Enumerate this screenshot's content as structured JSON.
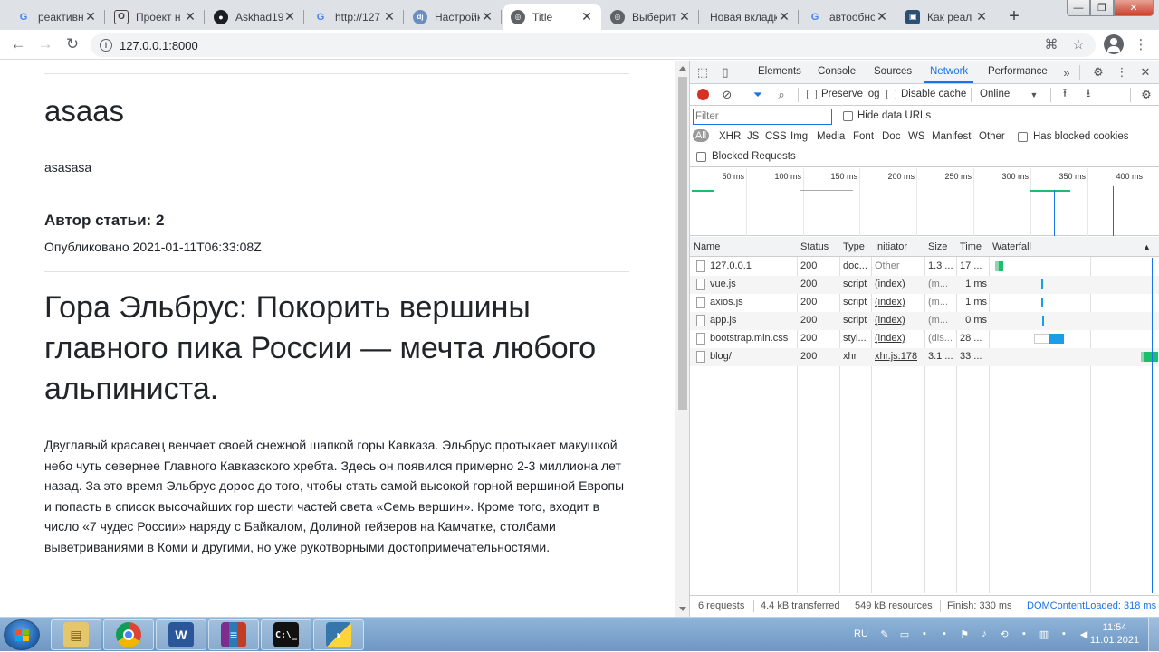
{
  "browser": {
    "tabs": [
      {
        "title": "реактивн",
        "favicon": "G",
        "color": "#4285f4"
      },
      {
        "title": "Проект н",
        "favicon": "◘",
        "color": "#444444"
      },
      {
        "title": "Askhad19",
        "favicon": "●",
        "color": "#1b1f23"
      },
      {
        "title": "http://127",
        "favicon": "G",
        "color": "#4285f4"
      },
      {
        "title": "Настройк",
        "favicon": "dj",
        "color": "#6b8ec2"
      },
      {
        "title": "Title",
        "favicon": "◉",
        "color": "#5f6368"
      },
      {
        "title": "Выберит",
        "favicon": "◉",
        "color": "#5f6368"
      },
      {
        "title": "Новая вкладк",
        "favicon": "",
        "color": "#5f6368"
      },
      {
        "title": "автообно",
        "favicon": "G",
        "color": "#4285f4"
      },
      {
        "title": "Как реал",
        "favicon": "▣",
        "color": "#2d4f73"
      }
    ],
    "url": "127.0.0.1:8000"
  },
  "page": {
    "title": "asaas",
    "body": "asasasa",
    "author": "Автор статьи: 2",
    "published": "Опубликовано 2021-01-11T06:33:08Z",
    "heading": "Гора Эльбрус: Покорить вершины главного пика России — мечта любого альпиниста.",
    "paragraph": "Двуглавый красавец венчает своей снежной шапкой горы Кавказа. Эльбрус протыкает макушкой небо чуть севернее Главного Кавказского хребта. Здесь он появился примерно 2-3 миллиона лет назад. За это время Эльбрус дорос до того, чтобы стать самой высокой горной вершиной Европы и попасть в список высочайших гор шести частей света «Семь вершин». Кроме того, входит в число «7 чудес России» наряду с Байкалом, Долиной гейзеров на Камчатке, столбами выветриваниями в Коми и другими, но уже рукотворными достопримечательностями."
  },
  "devtools": {
    "tabs": [
      "Elements",
      "Console",
      "Sources",
      "Network",
      "Performance"
    ],
    "active_tab": "Network",
    "toolbar": {
      "preserve_log": "Preserve log",
      "disable_cache": "Disable cache",
      "throttle": "Online"
    },
    "filter": {
      "placeholder": "Filter",
      "hide_data_urls": "Hide data URLs",
      "types": [
        "All",
        "XHR",
        "JS",
        "CSS",
        "Img",
        "Media",
        "Font",
        "Doc",
        "WS",
        "Manifest",
        "Other"
      ],
      "has_blocked_cookies": "Has blocked cookies",
      "blocked_requests": "Blocked Requests"
    },
    "overview_ticks": [
      "50 ms",
      "100 ms",
      "150 ms",
      "200 ms",
      "250 ms",
      "300 ms",
      "350 ms",
      "400 ms"
    ],
    "columns": [
      "Name",
      "Status",
      "Type",
      "Initiator",
      "Size",
      "Time",
      "Waterfall"
    ],
    "rows": [
      {
        "name": "127.0.0.1",
        "status": "200",
        "type": "doc...",
        "initiator": "Other",
        "size": "1.3 ...",
        "time": "17 ..."
      },
      {
        "name": "vue.js",
        "status": "200",
        "type": "script",
        "initiator": "(index)",
        "size": "(m...",
        "time": "1 ms"
      },
      {
        "name": "axios.js",
        "status": "200",
        "type": "script",
        "initiator": "(index)",
        "size": "(m...",
        "time": "1 ms"
      },
      {
        "name": "app.js",
        "status": "200",
        "type": "script",
        "initiator": "(index)",
        "size": "(m...",
        "time": "0 ms"
      },
      {
        "name": "bootstrap.min.css",
        "status": "200",
        "type": "styl...",
        "initiator": "(index)",
        "size": "(dis...",
        "time": "28 ..."
      },
      {
        "name": "blog/",
        "status": "200",
        "type": "xhr",
        "initiator": "xhr.js:178",
        "size": "3.1 ...",
        "time": "33 ..."
      }
    ],
    "status_bar": {
      "requests": "6 requests",
      "transferred": "4.4 kB transferred",
      "resources": "549 kB resources",
      "finish": "Finish: 330 ms",
      "dcl": "DOMContentLoaded: 318 ms"
    }
  },
  "taskbar": {
    "apps": [
      {
        "name": "explorer",
        "icon": "folder-icon"
      },
      {
        "name": "chrome",
        "icon": "chrome-icon"
      },
      {
        "name": "word",
        "icon": "word-icon"
      },
      {
        "name": "winrar",
        "icon": "winrar-icon"
      },
      {
        "name": "cmd",
        "icon": "terminal-icon"
      },
      {
        "name": "python",
        "icon": "python-icon"
      }
    ],
    "lang": "RU",
    "time": "11:54",
    "date": "11.01.2021"
  },
  "colors": {
    "accent": "#1a73e8",
    "record": "#d93025"
  }
}
